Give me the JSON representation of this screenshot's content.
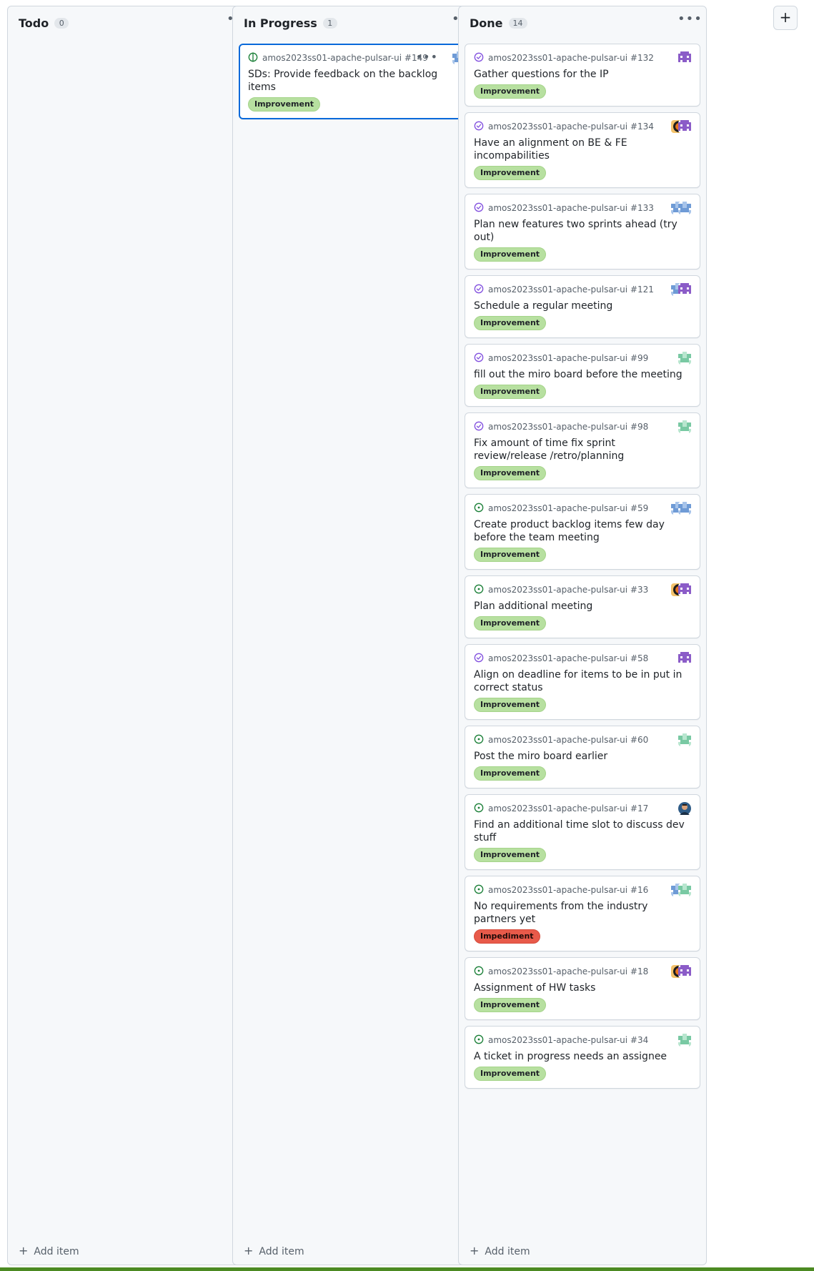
{
  "columns": [
    {
      "title": "Todo",
      "count": "0",
      "add_label": "Add item",
      "cards": []
    },
    {
      "title": "In Progress",
      "count": "1",
      "add_label": "Add item",
      "cards": [
        {
          "repo": "amos2023ss01-apache-pulsar-ui #149",
          "title": "SDs: Provide feedback on the backlog items",
          "label": "Improvement",
          "status": "draft",
          "avatars": [
            "blue-pixel"
          ],
          "selected": true
        }
      ]
    },
    {
      "title": "Done",
      "count": "14",
      "add_label": "Add item",
      "cards": [
        {
          "repo": "amos2023ss01-apache-pulsar-ui #132",
          "title": "Gather questions for the IP",
          "label": "Improvement",
          "status": "closed",
          "avatars": [
            "purple-pixel"
          ]
        },
        {
          "repo": "amos2023ss01-apache-pulsar-ui #134",
          "title": "Have an alignment on BE & FE incompabilities",
          "label": "Improvement",
          "status": "closed",
          "avatars": [
            "orange-photo",
            "purple-pixel"
          ]
        },
        {
          "repo": "amos2023ss01-apache-pulsar-ui #133",
          "title": "Plan new features two sprints ahead (try out)",
          "label": "Improvement",
          "status": "closed",
          "avatars": [
            "blue-pixel",
            "blue-pixel"
          ]
        },
        {
          "repo": "amos2023ss01-apache-pulsar-ui #121",
          "title": "Schedule a regular meeting",
          "label": "Improvement",
          "status": "closed",
          "avatars": [
            "blue-pixel",
            "purple-pixel"
          ]
        },
        {
          "repo": "amos2023ss01-apache-pulsar-ui #99",
          "title": "fill out the miro board before the meeting",
          "label": "Improvement",
          "status": "closed",
          "avatars": [
            "green-pixel"
          ]
        },
        {
          "repo": "amos2023ss01-apache-pulsar-ui #98",
          "title": "Fix amount of time fix sprint review/release /retro/planning",
          "label": "Improvement",
          "status": "closed",
          "avatars": [
            "green-pixel"
          ]
        },
        {
          "repo": "amos2023ss01-apache-pulsar-ui #59",
          "title": "Create product backlog items few day before the team meeting",
          "label": "Improvement",
          "status": "open",
          "avatars": [
            "blue-pixel",
            "blue-pixel"
          ]
        },
        {
          "repo": "amos2023ss01-apache-pulsar-ui #33",
          "title": "Plan additional meeting",
          "label": "Improvement",
          "status": "open",
          "avatars": [
            "orange-photo",
            "purple-pixel"
          ]
        },
        {
          "repo": "amos2023ss01-apache-pulsar-ui #58",
          "title": "Align on deadline for items to be in put in correct status",
          "label": "Improvement",
          "status": "closed",
          "avatars": [
            "purple-pixel"
          ]
        },
        {
          "repo": "amos2023ss01-apache-pulsar-ui #60",
          "title": "Post the miro board earlier",
          "label": "Improvement",
          "status": "open",
          "avatars": [
            "green-pixel"
          ]
        },
        {
          "repo": "amos2023ss01-apache-pulsar-ui #17",
          "title": "Find an additional time slot to discuss dev stuff",
          "label": "Improvement",
          "status": "open",
          "avatars": [
            "person-photo"
          ]
        },
        {
          "repo": "amos2023ss01-apache-pulsar-ui #16",
          "title": "No requirements from the industry partners yet",
          "label": "Impediment",
          "status": "open",
          "avatars": [
            "blue-pixel",
            "green-pixel"
          ]
        },
        {
          "repo": "amos2023ss01-apache-pulsar-ui #18",
          "title": "Assignment of HW tasks",
          "label": "Improvement",
          "status": "open",
          "avatars": [
            "orange-photo",
            "purple-pixel"
          ]
        },
        {
          "repo": "amos2023ss01-apache-pulsar-ui #34",
          "title": "A ticket in progress needs an assignee",
          "label": "Improvement",
          "status": "open",
          "avatars": [
            "green-pixel"
          ]
        }
      ]
    }
  ],
  "colors": {
    "improvement": "#b7e0a0",
    "impediment": "#e85a4a",
    "open_icon": "#1a7f37",
    "closed_icon": "#8250df",
    "selected_border": "#0969da"
  },
  "icons": {
    "column_menu": "kebab-horizontal-icon",
    "add": "plus-icon",
    "add_column": "plus-icon"
  },
  "add_column_label": "+"
}
